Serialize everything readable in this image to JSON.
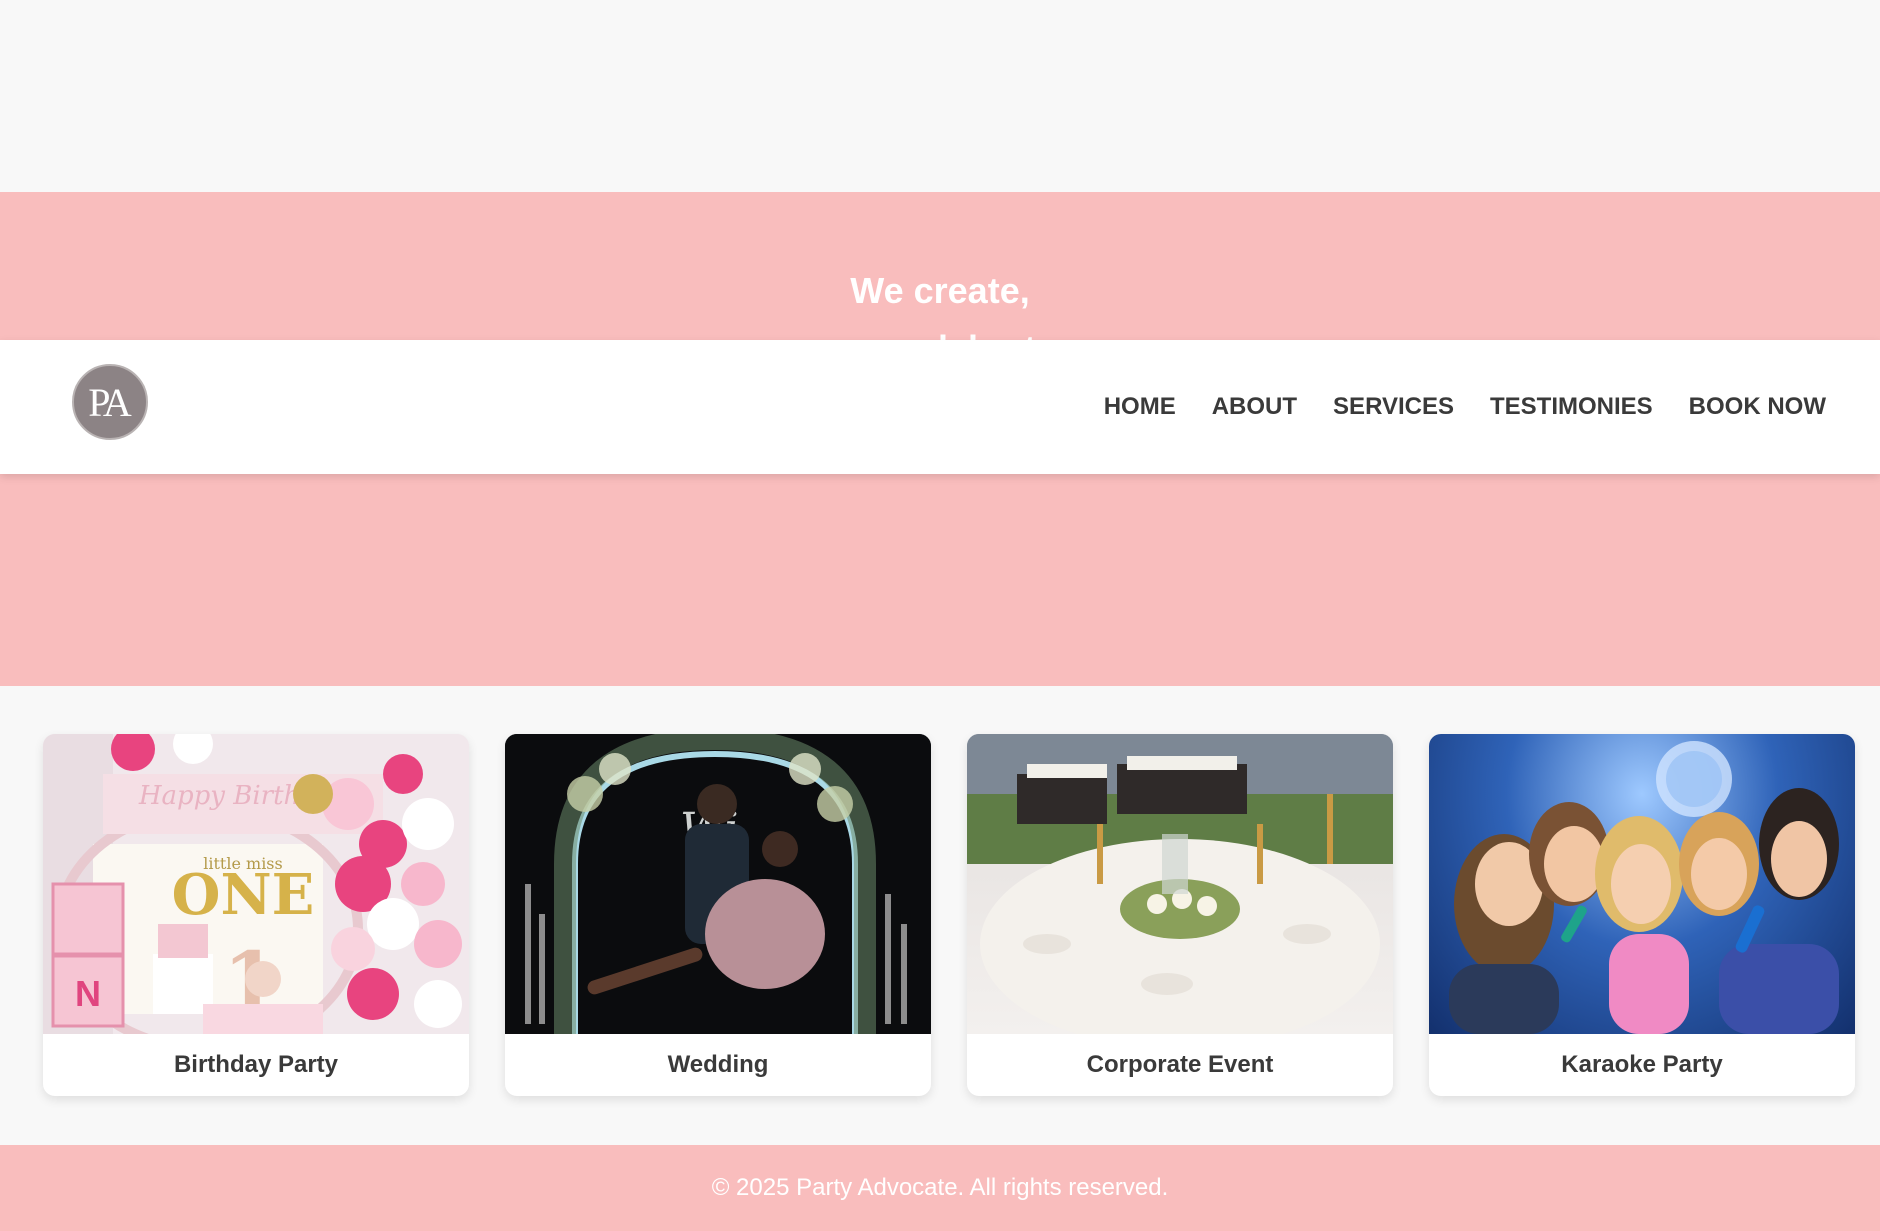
{
  "brand": {
    "logo_text": "PA"
  },
  "nav": {
    "items": [
      {
        "label": "HOME"
      },
      {
        "label": "ABOUT"
      },
      {
        "label": "SERVICES"
      },
      {
        "label": "TESTIMONIES"
      },
      {
        "label": "BOOK NOW"
      }
    ]
  },
  "hero": {
    "line1": "We create,",
    "line2": "you celebrate"
  },
  "services": {
    "cards": [
      {
        "label": "Birthday Party"
      },
      {
        "label": "Wedding"
      },
      {
        "label": "Corporate Event"
      },
      {
        "label": "Karaoke Party"
      }
    ]
  },
  "footer": {
    "text": "© 2025 Party Advocate. All rights reserved."
  },
  "colors": {
    "hero_bg": "#f9bdbd",
    "page_bg": "#f8f8f8",
    "nav_text": "#3a3a3a",
    "footer_bg": "#f9bdbd"
  }
}
